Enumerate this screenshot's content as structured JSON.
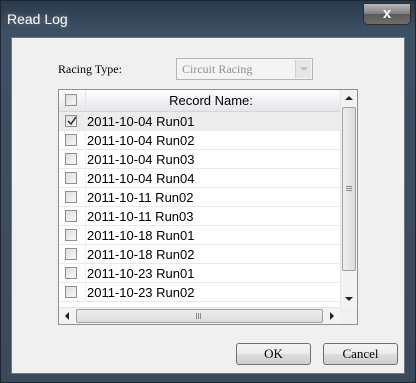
{
  "window": {
    "title": "Read Log",
    "close_symbol": "x"
  },
  "racing_type": {
    "label": "Racing Type:",
    "value": "Circuit Racing"
  },
  "table": {
    "header": "Record Name:",
    "rows": [
      {
        "name": "2011-10-04 Run01",
        "checked": true
      },
      {
        "name": "2011-10-04 Run02",
        "checked": false
      },
      {
        "name": "2011-10-04 Run03",
        "checked": false
      },
      {
        "name": "2011-10-04 Run04",
        "checked": false
      },
      {
        "name": "2011-10-11 Run02",
        "checked": false
      },
      {
        "name": "2011-10-11 Run03",
        "checked": false
      },
      {
        "name": "2011-10-18 Run01",
        "checked": false
      },
      {
        "name": "2011-10-18 Run02",
        "checked": false
      },
      {
        "name": "2011-10-23 Run01",
        "checked": false
      },
      {
        "name": "2011-10-23 Run02",
        "checked": false
      }
    ]
  },
  "buttons": {
    "ok": "OK",
    "cancel": "Cancel"
  },
  "icons": {
    "close": "close-icon",
    "dropdown": "chevron-down-icon",
    "check": "checkmark-icon",
    "scroll_up": "arrow-up-icon",
    "scroll_down": "arrow-down-icon",
    "scroll_left": "arrow-left-icon",
    "scroll_right": "arrow-right-icon"
  }
}
